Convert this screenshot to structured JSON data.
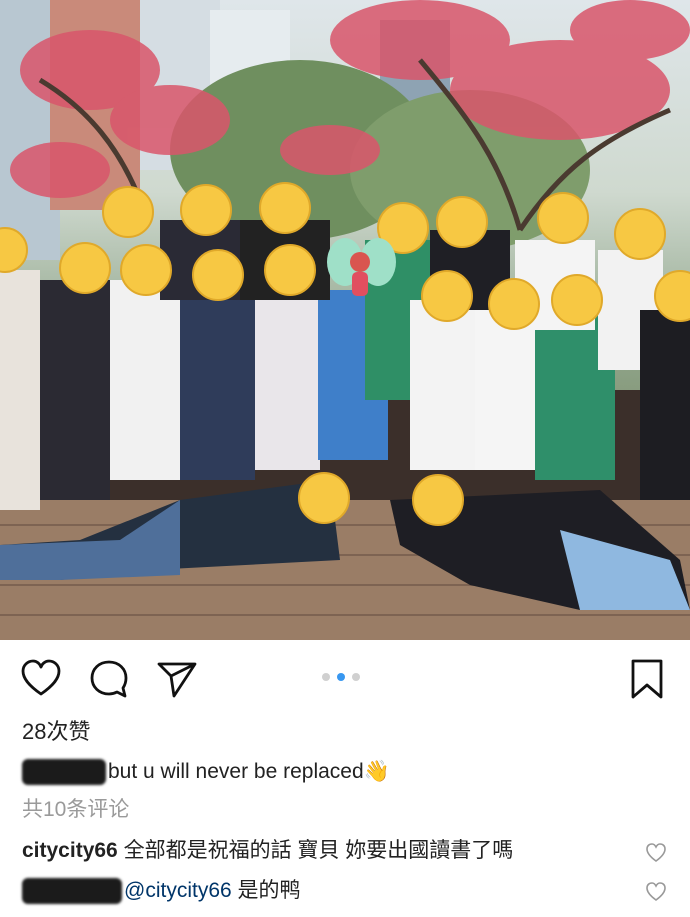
{
  "post": {
    "image_alt": "",
    "colors": {
      "accent": "#3897f0",
      "text": "#222222",
      "muted": "#9a9a9a",
      "mention": "#003569"
    }
  },
  "actions": {
    "like_icon": "heart-outline-icon",
    "comment_icon": "speech-bubble-icon",
    "share_icon": "paper-plane-icon",
    "save_icon": "bookmark-icon"
  },
  "carousel": {
    "total": 3,
    "active_index": 1
  },
  "likes_text": "28次赞",
  "caption": {
    "text": "but u will never be replaced",
    "emoji": "👋"
  },
  "view_all_comments": "共10条评论",
  "comments": [
    {
      "username": "citycity66",
      "text": "全部都是祝福的話 寶貝 妳要出國讀書了嗎"
    },
    {
      "mention": "@citycity66",
      "text": "是的鸭"
    }
  ]
}
